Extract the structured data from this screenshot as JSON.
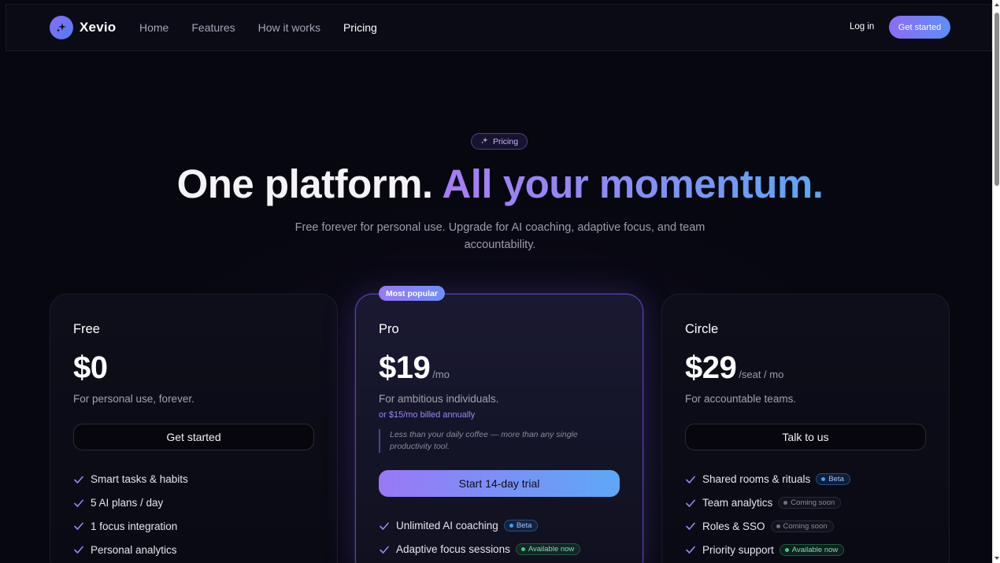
{
  "nav": {
    "brand": "Xevio",
    "links": [
      "Home",
      "Features",
      "How it works",
      "Pricing"
    ],
    "active_link": "Pricing",
    "login": "Log in",
    "cta": "Get started"
  },
  "hero": {
    "pill": "Pricing",
    "title_plain": "One platform.",
    "title_gradient": "All your momentum.",
    "subtitle": "Free forever for personal use. Upgrade for AI coaching, adaptive focus, and team accountability."
  },
  "plans": {
    "free": {
      "name": "Free",
      "price": "$0",
      "unit": "",
      "tagline": "For personal use, forever.",
      "button": "Get started",
      "features": [
        {
          "text": "Smart tasks & habits"
        },
        {
          "text": "5 AI plans / day"
        },
        {
          "text": "1 focus integration"
        },
        {
          "text": "Personal analytics"
        }
      ]
    },
    "pro": {
      "badge": "Most popular",
      "name": "Pro",
      "price": "$19",
      "unit": "/mo",
      "tagline": "For ambitious individuals.",
      "annual": "or $15/mo billed annually",
      "quote": "Less than your daily coffee — more than any single productivity tool.",
      "button": "Start 14-day trial",
      "features": [
        {
          "text": "Unlimited AI coaching",
          "badge": "Beta",
          "badge_type": "beta"
        },
        {
          "text": "Adaptive focus sessions",
          "badge": "Available now",
          "badge_type": "avail"
        }
      ]
    },
    "circle": {
      "name": "Circle",
      "price": "$29",
      "unit": "/seat / mo",
      "tagline": "For accountable teams.",
      "button": "Talk to us",
      "features": [
        {
          "text": "Shared rooms & rituals",
          "badge": "Beta",
          "badge_type": "beta"
        },
        {
          "text": "Team analytics",
          "badge": "Coming soon",
          "badge_type": "soon"
        },
        {
          "text": "Roles & SSO",
          "badge": "Coming soon",
          "badge_type": "soon"
        },
        {
          "text": "Priority support",
          "badge": "Available now",
          "badge_type": "avail"
        }
      ]
    }
  },
  "colors": {
    "background": "#07070f",
    "accent_purple": "#8b6cf6",
    "accent_blue": "#5ea8f6",
    "check": "#9b86f7"
  },
  "icons": {
    "logo": "sparkle-icon",
    "pill": "sparkle-icon",
    "feature": "check-icon"
  }
}
